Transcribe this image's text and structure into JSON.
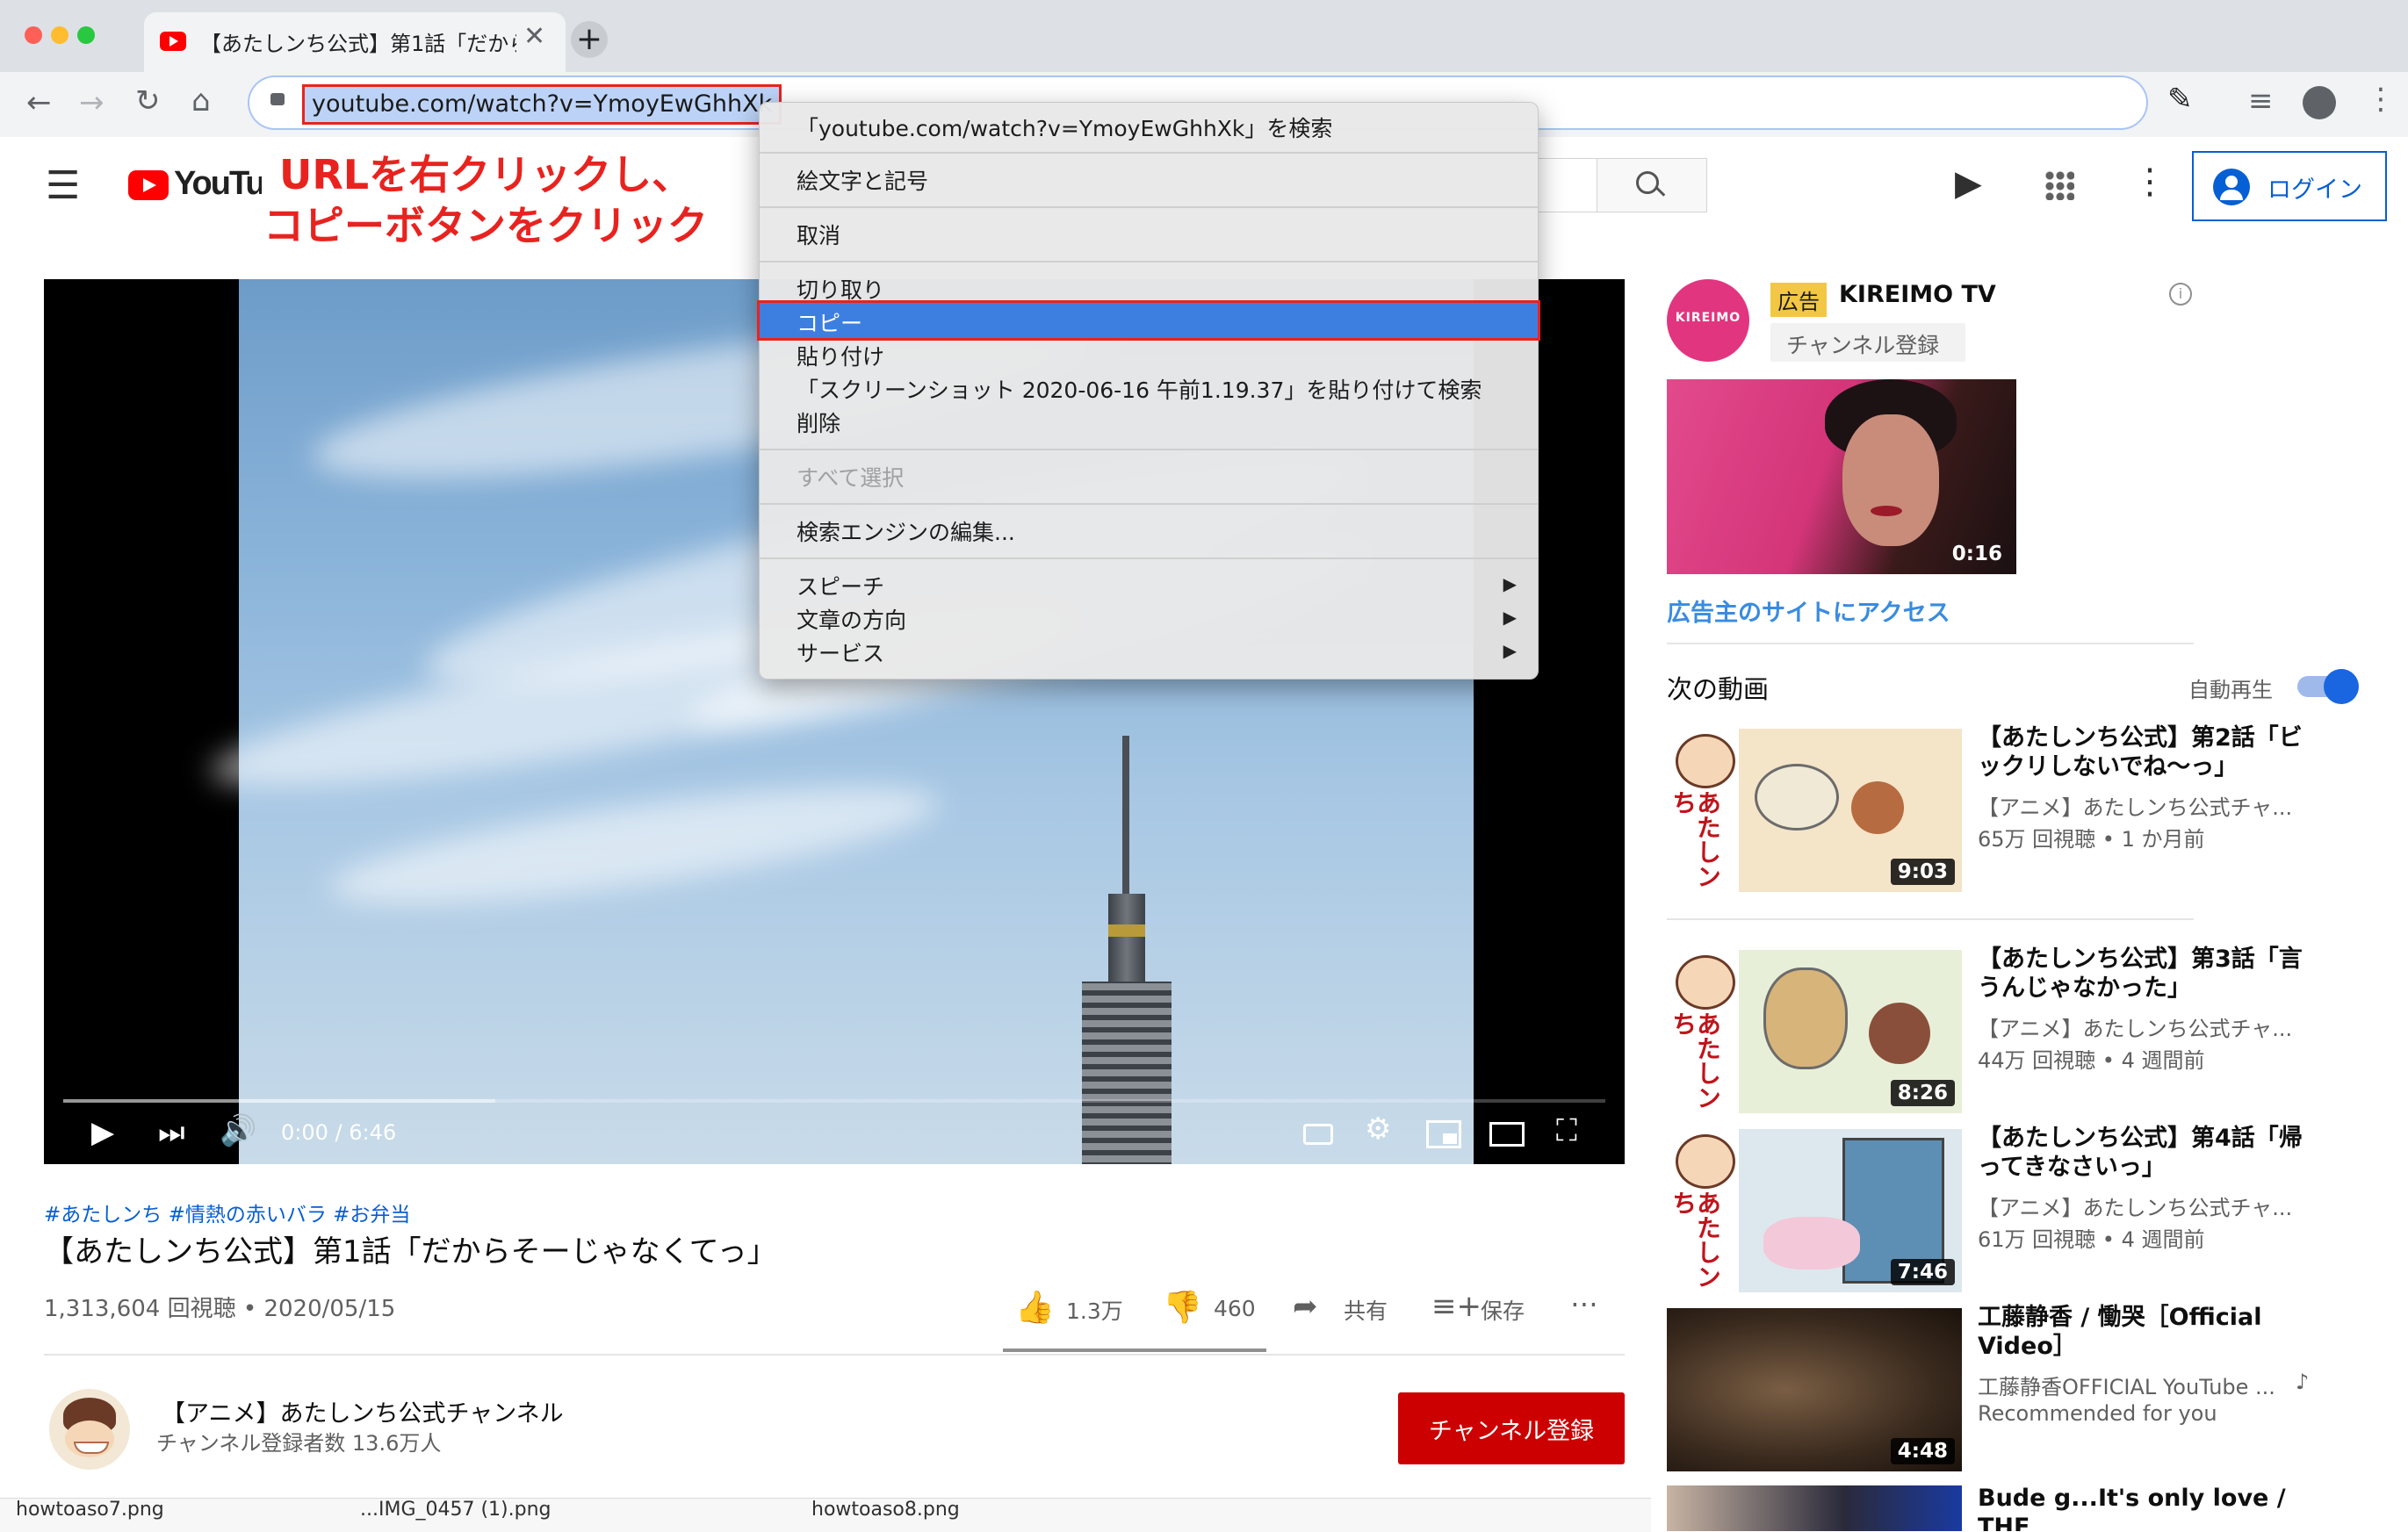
{
  "browser": {
    "tab_title": "【あたしンち公式】第1話「だから",
    "url": "youtube.com/watch?v=YmoyEwGhhXk"
  },
  "annotation": {
    "line1": "URLを右クリックし、",
    "line2": "コピーボタンをクリック"
  },
  "context_menu": {
    "search": "「youtube.com/watch?v=YmoyEwGhhXk」を検索",
    "emoji": "絵文字と記号",
    "undo": "取消",
    "cut": "切り取り",
    "copy": "コピー",
    "paste": "貼り付け",
    "paste_search": "「スクリーンショット 2020-06-16 午前1.19.37」を貼り付けて検索",
    "delete": "削除",
    "select_all": "すべて選択",
    "edit_engines": "検索エンジンの編集...",
    "speech": "スピーチ",
    "direction": "文章の方向",
    "services": "サービス"
  },
  "youtube": {
    "logo": "YouTube",
    "login": "ログイン"
  },
  "video": {
    "time": "0:00 / 6:46",
    "progress": 0.0,
    "buffered": 0.28,
    "hashtags": "#あたしンち #情熱の赤いバラ #お弁当",
    "title": "【あたしンち公式】第1話「だからそーじゃなくてっ」",
    "views": "1,313,604 回視聴 • 2020/05/15",
    "likes": "1.3万",
    "dislikes": "460",
    "share": "共有",
    "save": "保存"
  },
  "channel": {
    "name": "【アニメ】あたしンち公式チャンネル",
    "subs": "チャンネル登録者数 13.6万人",
    "subscribe": "チャンネル登録"
  },
  "ad": {
    "logo": "KIREIMO",
    "badge": "広告",
    "name": "KIREIMO TV",
    "subscribe": "チャンネル登録",
    "duration": "0:16",
    "link": "広告主のサイトにアクセス"
  },
  "upnext": {
    "heading": "次の動画",
    "autoplay": "自動再生",
    "autoplay_on": true,
    "items": [
      {
        "title": "【あたしンち公式】第2話「ビックリしないでね〜っ」",
        "channel": "【アニメ】あたしンち公式チャ...",
        "meta": "65万 回視聴 • 1 か月前",
        "duration": "9:03"
      },
      {
        "title": "【あたしンち公式】第3話「言うんじゃなかった」",
        "channel": "【アニメ】あたしンち公式チャ...",
        "meta": "44万 回視聴 • 4 週間前",
        "duration": "8:26"
      },
      {
        "title": "【あたしンち公式】第4話「帰ってきなさいっ」",
        "channel": "【アニメ】あたしンち公式チャ...",
        "meta": "61万 回視聴 • 4 週間前",
        "duration": "7:46"
      },
      {
        "title": "工藤静香 / 慟哭［Official Video］",
        "channel": "工藤静香OFFICIAL YouTube ...",
        "meta": "Recommended for you",
        "duration": "4:48"
      },
      {
        "title": "Bude g...It's only love / THE",
        "channel": "",
        "meta": "",
        "duration": ""
      }
    ],
    "thumb_side_label": "あたしンち"
  },
  "downloads": {
    "items": [
      "howtoaso7.png",
      "...IMG_0457 (1).png",
      "howtoaso8.png"
    ]
  },
  "colors": {
    "yt_red": "#ff0000",
    "annotation_red": "#e8231f",
    "menu_highlight": "#3d7fe0",
    "link_blue": "#065fd4",
    "subscribe_red": "#cc0000",
    "ad_badge": "#f2c744"
  }
}
